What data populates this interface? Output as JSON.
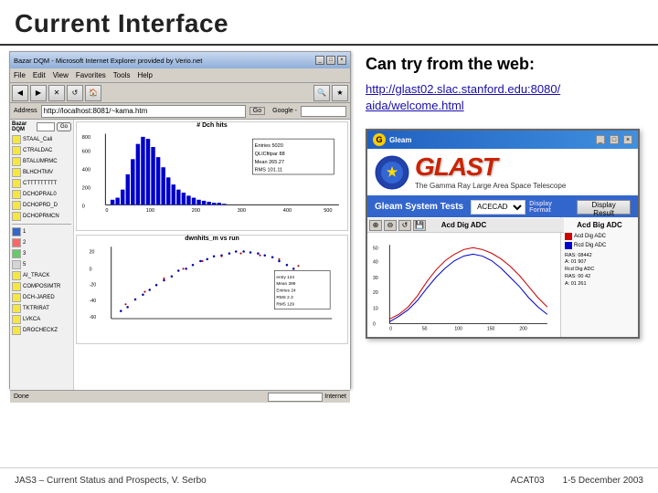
{
  "header": {
    "title": "Current Interface"
  },
  "right_panel": {
    "can_try_label": "Can try from the web:",
    "url_line1": "http://glast02.slac.stanford.edu:8080/",
    "url_line2": "aida/welcome.html"
  },
  "browser": {
    "titlebar_text": "Bazar DQM - Microsoft Internet Explorer provided by Verio.net",
    "address": "http://localhost:8081/~kama.htm",
    "google_label": "Google -",
    "menus": [
      "File",
      "Edit",
      "View",
      "Favorites",
      "Tools",
      "Help"
    ],
    "sidebar_items": [
      "STAAL_Cali",
      "CTRALDAC",
      "BTALUMRMC",
      "BLHCHTMV",
      "CTTTTTTTTT",
      "DCHOPRAL0",
      "DCHOPRD_D",
      "DCHOPRMCN",
      "1",
      "2",
      "3",
      "5",
      "AI_TRACK",
      "COMPOSIMTR",
      "DCHJARED",
      "TKTRIRAT",
      "LVKCA",
      "DROCHECKZ"
    ],
    "upper_chart_title": "# Dch hits",
    "upper_chart_legend": {
      "entries": "Entries 5020",
      "mean": "Mean 265.27",
      "rms": "RMS 101.11"
    },
    "lower_chart_title": "dwnhits_m vs run"
  },
  "glast": {
    "logo": "GLAST",
    "subtitle": "The Gamma Ray Large Area Space Telescope",
    "system": "Gleam System Tests",
    "dropdown": "ACECADC",
    "display_label": "Display Format",
    "button": "Display Result",
    "chart_title": "Acd Dig ADC",
    "icon": "🔮",
    "legend_items": [
      {
        "color": "#cc0000",
        "label": "Acd Dig ADC"
      },
      {
        "color": "#0000cc",
        "label": "Rcd Dig ADC"
      },
      {
        "color": "#cc0000",
        "label": "RAS: 08442"
      },
      {
        "color": "#0000cc",
        "label": "A: 01 907"
      },
      {
        "color": "#cc0000",
        "label": "RAS: 00 42"
      }
    ]
  },
  "footer": {
    "left": "JAS3 – Current Status and Prospects, V. Serbo",
    "conference": "ACAT03",
    "dates": "1-5 December 2003"
  }
}
